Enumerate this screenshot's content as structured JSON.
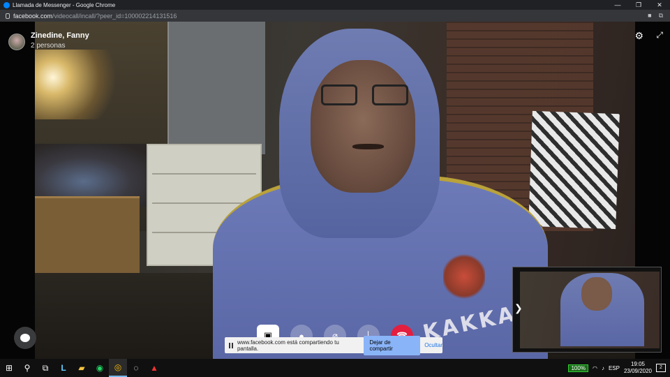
{
  "window": {
    "title": "Llamada de Messenger - Google Chrome",
    "controls": [
      "—",
      "❐",
      "✕"
    ]
  },
  "address_bar": {
    "host": "facebook.com",
    "path": "/videocall/incall/?peer_id=100002214131516"
  },
  "call": {
    "peer_name": "Zinedine, Fanny",
    "participants": "2 personas",
    "shirt_text": "KAKKA"
  },
  "share_banner": {
    "message": "www.facebook.com está compartiendo tu pantalla.",
    "stop_label": "Dejar de compartir",
    "hide_label": "Ocultar"
  },
  "taskbar": {
    "battery": "100%",
    "language": "ESP",
    "time": "19:05",
    "date": "23/09/2020",
    "notifications": "2"
  },
  "colors": {
    "end_call": "#e41e3f",
    "messenger_blue": "#0084ff",
    "stop_share_button": "#8ab4f8"
  }
}
